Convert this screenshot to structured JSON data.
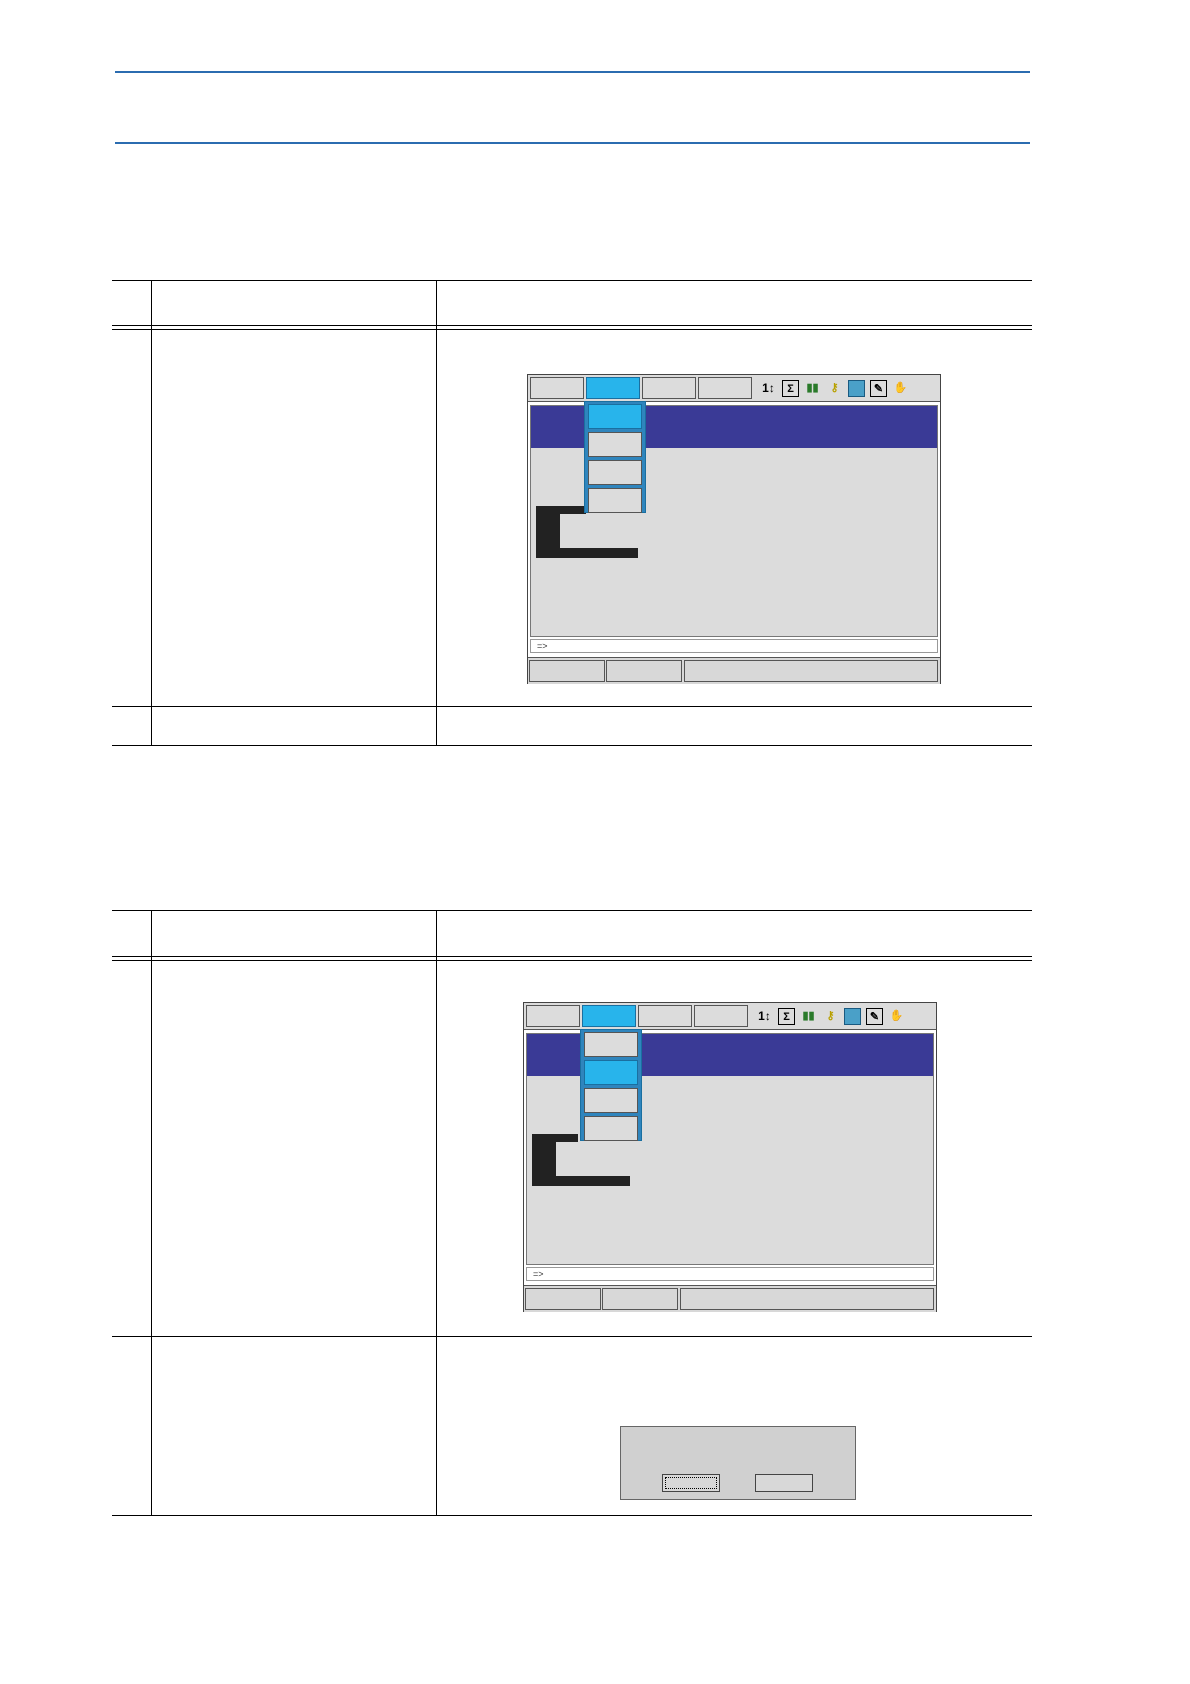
{
  "pendant_screen_1": {
    "menu_tabs": [
      "",
      "",
      "",
      ""
    ],
    "active_tab_index": 1,
    "dropdown_items": [
      "",
      "",
      "",
      ""
    ],
    "selected_dropdown_index": 0,
    "input_prompt": "=>",
    "bottom_buttons": [
      "",
      "",
      ""
    ]
  },
  "pendant_screen_2": {
    "menu_tabs": [
      "",
      "",
      "",
      ""
    ],
    "active_tab_index": 1,
    "dropdown_items": [
      "",
      "",
      "",
      ""
    ],
    "selected_dropdown_index": 1,
    "input_prompt": "=>",
    "bottom_buttons": [
      "",
      "",
      ""
    ]
  },
  "status_icons": [
    "sequence-icon",
    "sigma-icon",
    "chart-icon",
    "key-icon",
    "storage-icon",
    "edit-icon",
    "hand-icon"
  ],
  "dialog": {
    "buttons": [
      "",
      ""
    ],
    "focused_button_index": 0
  },
  "colors": {
    "rule_blue": "#2b6cb0",
    "menu_active": "#28b4eb",
    "title_bar": "#3a3a96",
    "screen_bg": "#dcdcdc"
  }
}
